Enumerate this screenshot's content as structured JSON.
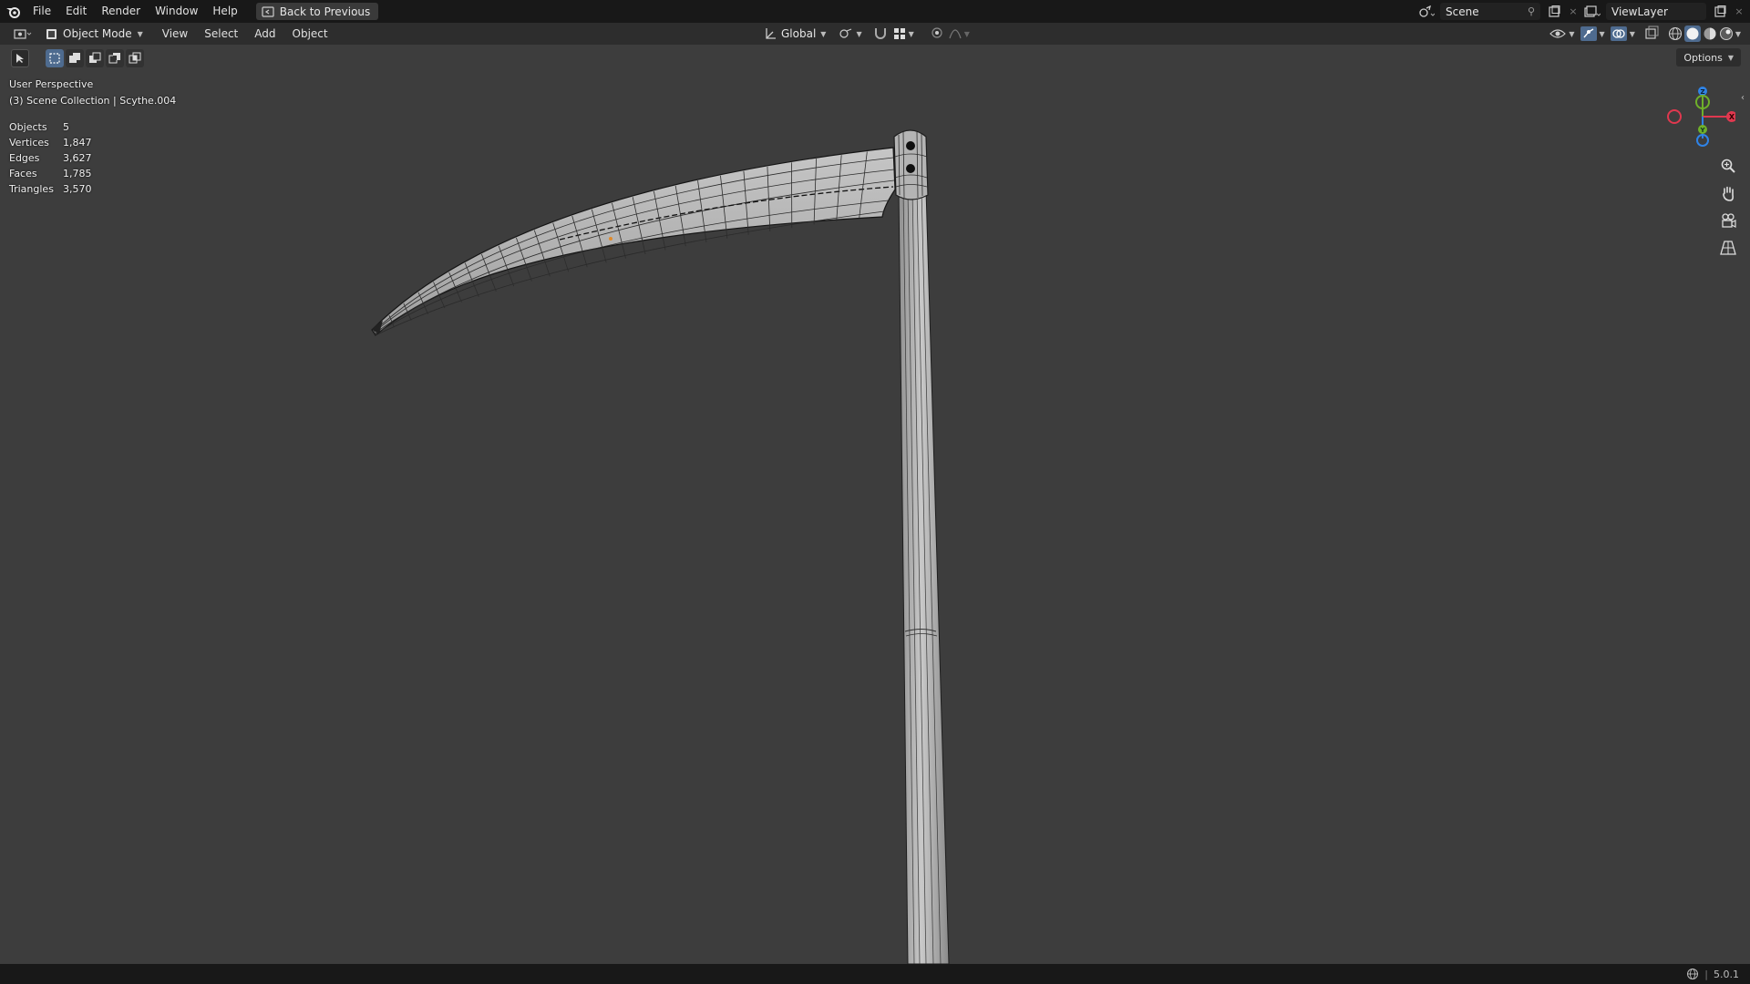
{
  "topbar": {
    "menus": [
      "File",
      "Edit",
      "Render",
      "Window",
      "Help"
    ],
    "back_label": "Back to Previous",
    "scene_name": "Scene",
    "view_layer": "ViewLayer"
  },
  "header": {
    "mode": "Object Mode",
    "menus": [
      "View",
      "Select",
      "Add",
      "Object"
    ],
    "transform_orientation": "Global",
    "options_label": "Options"
  },
  "viewport": {
    "view_name": "User Perspective",
    "collection_info": "(3) Scene Collection | Scythe.004",
    "stats": [
      {
        "label": "Objects",
        "value": "5"
      },
      {
        "label": "Vertices",
        "value": "1,847"
      },
      {
        "label": "Edges",
        "value": "3,627"
      },
      {
        "label": "Faces",
        "value": "1,785"
      },
      {
        "label": "Triangles",
        "value": "3,570"
      }
    ],
    "gizmo_axes": {
      "x": "X",
      "y": "Y",
      "z": "Z"
    }
  },
  "status": {
    "version": "5.0.1"
  },
  "colors": {
    "axis_x": "#e0384f",
    "axis_y": "#6fb02a",
    "axis_z": "#2f83e6",
    "accent": "#4e6b8f"
  }
}
